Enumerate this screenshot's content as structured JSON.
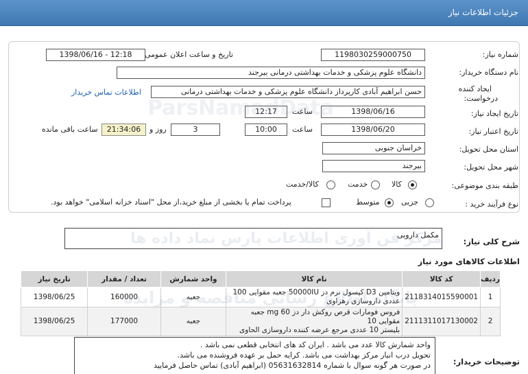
{
  "header": {
    "title": "جزئیات اطلاعات نیاز"
  },
  "form": {
    "need_number_label": "شماره نیاز:",
    "need_number": "1198030259000750",
    "announce_label": "تاریخ و ساعت اعلان عمومی:",
    "announce_value": "1398/06/16 - 12:18",
    "buyer_label": "نام دستگاه خریدار:",
    "buyer_value": "دانشگاه علوم پزشکی و خدمات بهداشتی درمانی بیرجند",
    "creator_label_1": "ایجاد کننده",
    "creator_label_2": "درخواست:",
    "creator_value": "حسن ابراهیم آبادی کارپرداز دانشگاه علوم پزشکی و خدمات بهداشتی درمانی",
    "contact_link": "اطلاعات تماس خریدار",
    "create_date_label": "تاریخ ایجاد نیاز:",
    "create_date": "1398/06/16",
    "time_label": "ساعت",
    "create_time": "12:17",
    "validity_label": "تاریخ اعتبار نیاز:",
    "validity_date": "1398/06/20",
    "validity_time": "10:00",
    "days_value": "3",
    "days_label": "روز و",
    "remaining_time": "21:34:06",
    "remaining_label": "ساعت باقی مانده",
    "province_label": "استان محل تحویل:",
    "province_value": "خراسان جنوبی",
    "city_label": "شهر محل تحویل:",
    "city_value": "بیرجند",
    "category_label": "طبقه بندی موضوعی:",
    "category_options": [
      "کالا",
      "خدمت",
      "کالا/خدمت"
    ],
    "category_selected": 0,
    "process_label": "نوع فرآیند خرید :",
    "process_options": [
      "جزیی",
      "متوسط"
    ],
    "process_selected": 1,
    "payment_note": "پرداخت تمام یا بخشی از مبلغ خرید،از محل \"اسناد خزانه اسلامی\" خواهد بود."
  },
  "description": {
    "label": "شرح کلی نیاز:",
    "value": "مکمل دارویی"
  },
  "items_section": {
    "title": "اطلاعات کالاهای مورد نیاز",
    "columns": [
      "ردیف",
      "کد کالا",
      "نام کالا",
      "واحد شمارش",
      "تعداد / مقدار",
      "تاریخ نیاز"
    ],
    "rows": [
      {
        "row": "1",
        "code": "2118314015590001",
        "name_line1": "ویتامین D3 کپسول نرم دز 50000IU جعبه مقوایی 100",
        "name_line2": "عددی داروسازی زهراوی",
        "unit": "جعبه",
        "qty": "160000",
        "date": "1398/06/25"
      },
      {
        "row": "2",
        "code": "2111311017130002",
        "name_line1": "فروس فومارات قرص روکش دار دز 60 mg جعبه مقوایی 10",
        "name_line2": "بلیستر 10 عددی مرجع عرضه کننده داروسازی الحاوی",
        "unit": "جعبه",
        "qty": "177000",
        "date": "1398/06/25"
      }
    ]
  },
  "buyer_notes": {
    "label": "توضیحات خریدار:",
    "lines": [
      "واحد شمارش کالا عدد می باشد . ایران کد های انتخابی قطعی نمی باشد .",
      "تحویل درب انبار مرکز بهداشت می باشد. کرایه حمل بر عهده فروشنده می باشد.",
      "در صورت هر گونه سوال با شماره 05631632814 (ابراهیم آبادی) تماس حاصل فرمایید"
    ]
  },
  "watermarks": {
    "line1": "مرکز فن آوری اطلاعات پارس نماد داده ها",
    "line2": "پایگاه اطلاع رسانی مناقصه و مزایده",
    "brand": "ParsNamadData"
  }
}
